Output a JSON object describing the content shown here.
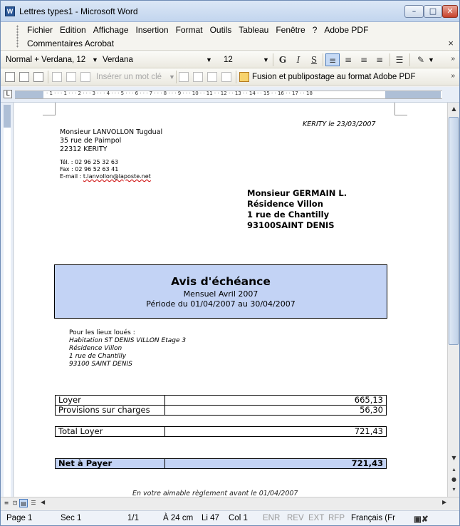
{
  "window": {
    "title": "Lettres types1 - Microsoft Word",
    "app_icon": "W"
  },
  "menubar": {
    "row1": [
      "Fichier",
      "Edition",
      "Affichage",
      "Insertion",
      "Format",
      "Outils",
      "Tableau",
      "Fenêtre",
      "?",
      "Adobe PDF"
    ],
    "row2": [
      "Commentaires Acrobat"
    ],
    "close_glyph": "×"
  },
  "toolbar1": {
    "style": "Normal + Verdana, 12",
    "font": "Verdana",
    "size": "12",
    "bold": "G",
    "italic": "I",
    "underline": "S"
  },
  "toolbar2": {
    "insert_keyword": "Insérer un mot clé",
    "fusion": "Fusion et publipostage au format Adobe PDF"
  },
  "document": {
    "date": "KERITY le 23/03/2007",
    "sender": {
      "name": "Monsieur LANVOLLON Tugdual",
      "street": "35 rue de Paimpol",
      "city": "22312 KERITY",
      "tel": "Tél. : 02 96 25 32 63",
      "fax": "Fax : 02 96 52 63 41",
      "email_label": "E-mail : ",
      "email": "t.lanvollon@laposte.net"
    },
    "recipient": {
      "name": "Monsieur GERMAIN L.",
      "residence": "Résidence Villon",
      "street": "1 rue de Chantilly",
      "city": "93100SAINT DENIS"
    },
    "avis": {
      "title": "Avis d'échéance",
      "subtitle": "Mensuel Avril 2007",
      "periode": "Période du 01/04/2007 au 30/04/2007"
    },
    "lieux": {
      "heading": "Pour les lieux loués :",
      "line1": "Habitation ST DENIS VILLON Etage 3",
      "line2": "Résidence Villon",
      "line3": "1 rue de Chantilly",
      "line4": "93100 SAINT DENIS"
    },
    "table1": [
      {
        "label": "Loyer",
        "value": "665,13"
      },
      {
        "label": "Provisions sur charges",
        "value": "56,30"
      }
    ],
    "table2": [
      {
        "label": "Total Loyer",
        "value": "721,43"
      }
    ],
    "table3": [
      {
        "label": "Net à Payer",
        "value": "721,43"
      }
    ],
    "footer": "En votre aimable règlement avant le 01/04/2007"
  },
  "statusbar": {
    "page": "Page 1",
    "sec": "Sec 1",
    "pages": "1/1",
    "at": "À 24 cm",
    "line": "Li 47",
    "col": "Col 1",
    "enr": "ENR",
    "rev": "REV",
    "ext": "EXT",
    "rfp": "RFP",
    "lang": "Français (Fr"
  },
  "colors": {
    "highlight_box": "#c3d3f5",
    "title_bar": "#c2d5ee"
  }
}
